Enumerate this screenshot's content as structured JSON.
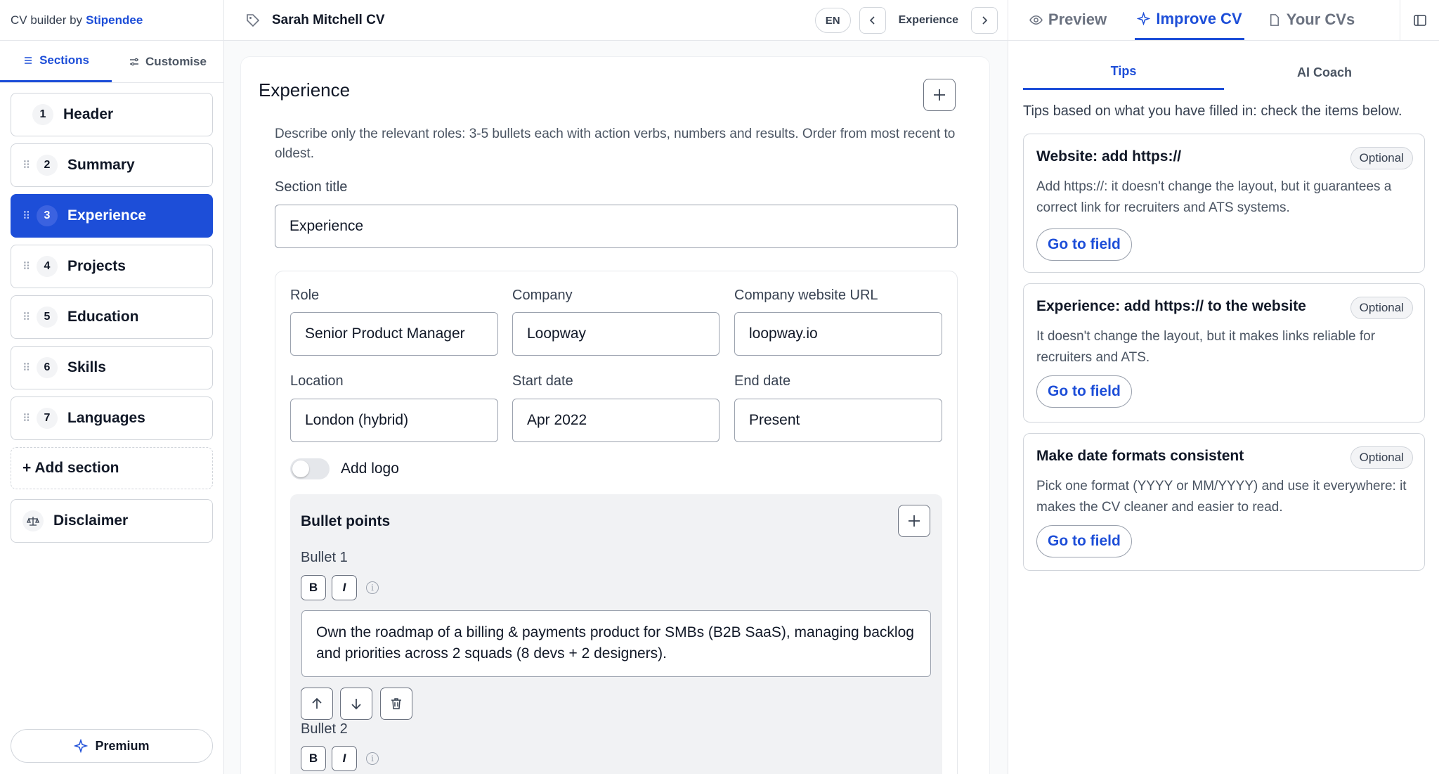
{
  "brand": {
    "prefix": "CV builder by",
    "name": "Stipendee"
  },
  "left_tabs": [
    {
      "label": "Sections",
      "active": true
    },
    {
      "label": "Customise",
      "active": false
    }
  ],
  "sections": [
    {
      "num": "1",
      "label": "Header"
    },
    {
      "num": "2",
      "label": "Summary"
    },
    {
      "num": "3",
      "label": "Experience"
    },
    {
      "num": "4",
      "label": "Projects"
    },
    {
      "num": "5",
      "label": "Education"
    },
    {
      "num": "6",
      "label": "Skills"
    },
    {
      "num": "7",
      "label": "Languages"
    }
  ],
  "active_section": "Experience",
  "add_section_label": "+ Add section",
  "disclaimer_label": "Disclaimer",
  "premium_label": "Premium",
  "header": {
    "doc_title": "Sarah Mitchell CV",
    "lang": "EN",
    "current_section": "Experience"
  },
  "editor": {
    "title": "Experience",
    "description": "Describe only the relevant roles: 3-5 bullets each with action verbs, numbers and results. Order from most recent to oldest.",
    "section_title_label": "Section title",
    "section_title_value": "Experience",
    "role_label": "Role",
    "role_value": "Senior Product Manager",
    "company_label": "Company",
    "company_value": "Loopway",
    "website_label": "Company website URL",
    "website_value": "loopway.io",
    "location_label": "Location",
    "location_value": "London (hybrid)",
    "start_label": "Start date",
    "start_value": "Apr 2022",
    "end_label": "End date",
    "end_value": "Present",
    "logo_label": "Add logo",
    "bullets_title": "Bullet points",
    "bullet1_label": "Bullet 1",
    "bullet1_text": "Own the roadmap of a billing & payments product for SMBs (B2B SaaS), managing backlog and priorities across 2 squads (8 devs + 2 designers).",
    "bullet2_label": "Bullet 2",
    "bold_label": "B",
    "italic_label": "I",
    "info_glyph": "i"
  },
  "right_tabs": [
    {
      "label": "Preview",
      "icon": "eye-icon"
    },
    {
      "label": "Improve CV",
      "icon": "sparkle-icon",
      "active": true
    },
    {
      "label": "Your CVs",
      "icon": "document-icon"
    }
  ],
  "sub_tabs": [
    {
      "label": "Tips",
      "active": true
    },
    {
      "label": "AI Coach"
    }
  ],
  "tips_intro": "Tips based on what you have filled in: check the items below.",
  "tips": [
    {
      "title": "Website: add https://",
      "badge": "Optional",
      "body": "Add https://: it doesn't change the layout, but it guarantees a correct link for recruiters and ATS systems.",
      "button": "Go to field"
    },
    {
      "title": "Experience: add https:// to the website",
      "badge": "Optional",
      "body": "It doesn't change the layout, but it makes links reliable for recruiters and ATS.",
      "button": "Go to field"
    },
    {
      "title": "Make date formats consistent",
      "badge": "Optional",
      "body": "Pick one format (YYYY or MM/YYYY) and use it everywhere: it makes the CV cleaner and easier to read.",
      "button": "Go to field"
    }
  ],
  "colors": {
    "accent": "#1d4ed8",
    "border": "#d1d5db",
    "muted": "#4b5563"
  }
}
